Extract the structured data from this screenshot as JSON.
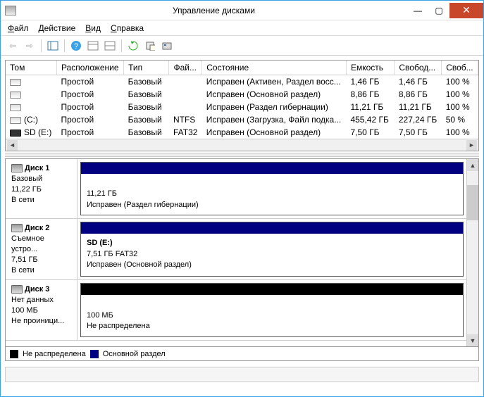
{
  "title": "Управление дисками",
  "menu": {
    "file": "Файл",
    "action": "Действие",
    "view": "Вид",
    "help": "Справка"
  },
  "columns": [
    "Том",
    "Расположение",
    "Тип",
    "Фай...",
    "Состояние",
    "Емкость",
    "Свобод...",
    "Своб..."
  ],
  "volumes": [
    {
      "icon": "disk",
      "tom": "",
      "loc": "Простой",
      "type": "Базовый",
      "fs": "",
      "state": "Исправен (Активен, Раздел восс...",
      "cap": "1,46 ГБ",
      "free": "1,46 ГБ",
      "pct": "100 %"
    },
    {
      "icon": "disk",
      "tom": "",
      "loc": "Простой",
      "type": "Базовый",
      "fs": "",
      "state": "Исправен (Основной раздел)",
      "cap": "8,86 ГБ",
      "free": "8,86 ГБ",
      "pct": "100 %"
    },
    {
      "icon": "disk",
      "tom": "",
      "loc": "Простой",
      "type": "Базовый",
      "fs": "",
      "state": "Исправен (Раздел гибернации)",
      "cap": "11,21 ГБ",
      "free": "11,21 ГБ",
      "pct": "100 %"
    },
    {
      "icon": "disk",
      "tom": "(C:)",
      "loc": "Простой",
      "type": "Базовый",
      "fs": "NTFS",
      "state": "Исправен (Загрузка, Файл подка...",
      "cap": "455,42 ГБ",
      "free": "227,24 ГБ",
      "pct": "50 %"
    },
    {
      "icon": "sd",
      "tom": "SD (E:)",
      "loc": "Простой",
      "type": "Базовый",
      "fs": "FAT32",
      "state": "Исправен (Основной раздел)",
      "cap": "7,50 ГБ",
      "free": "7,50 ГБ",
      "pct": "100 %"
    }
  ],
  "disks": [
    {
      "name": "Диск 1",
      "type": "Базовый",
      "size": "11,22 ГБ",
      "status": "В сети",
      "parts": [
        {
          "bar": "navy",
          "l1": "",
          "l2": "11,21 ГБ",
          "l3": "Исправен (Раздел гибернации)"
        }
      ]
    },
    {
      "name": "Диск 2",
      "type": "Съемное устро...",
      "size": "7,51 ГБ",
      "status": "В сети",
      "parts": [
        {
          "bar": "navy",
          "l1": "SD  (E:)",
          "l2": "7,51 ГБ FAT32",
          "l3": "Исправен (Основной раздел)"
        }
      ]
    },
    {
      "name": "Диск 3",
      "type": "Нет данных",
      "size": "100 МБ",
      "status": "Не проиници...",
      "parts": [
        {
          "bar": "black",
          "l1": "",
          "l2": "100 МБ",
          "l3": "Не распределена"
        }
      ]
    }
  ],
  "legend": {
    "unalloc": "Не распределена",
    "primary": "Основной раздел"
  }
}
